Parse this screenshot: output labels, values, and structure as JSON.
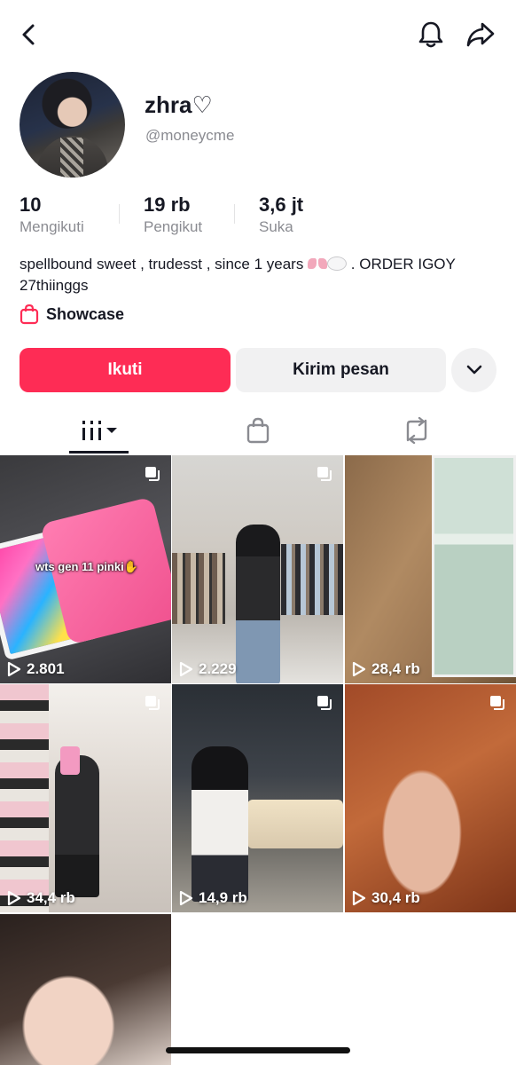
{
  "profile": {
    "name": "zhra♡",
    "handle": "@moneycme",
    "bio": {
      "text_before": "spellbound sweet , trudesst , since 1 years ",
      "text_after": " . ORDER IGOY 27thiinggs"
    },
    "showcase_label": "Showcase"
  },
  "stats": [
    {
      "value": "10",
      "label": "Mengikuti"
    },
    {
      "value": "19 rb",
      "label": "Pengikut"
    },
    {
      "value": "3,6 jt",
      "label": "Suka"
    }
  ],
  "actions": {
    "follow": "Ikuti",
    "message": "Kirim pesan"
  },
  "icons": {
    "back": "chevron-left-icon",
    "notification": "bell-icon",
    "share": "share-arrow-icon",
    "more": "chevron-down-icon",
    "tab_videos": "grid-bars-icon",
    "tab_shop": "shopping-bag-icon",
    "tab_repost": "repost-icon",
    "multi_photo": "stacked-photos-icon",
    "play": "play-icon"
  },
  "colors": {
    "accent": "#fe2c55",
    "secondary_button": "#f1f1f2",
    "muted_text": "#8a8b91"
  },
  "videos": [
    {
      "views": "2.801",
      "caption": "wts gen 11 pinki✋"
    },
    {
      "views": "2.229"
    },
    {
      "views": "28,4 rb"
    },
    {
      "views": "34,4 rb"
    },
    {
      "views": "14,9 rb"
    },
    {
      "views": "30,4 rb"
    },
    {
      "views": ""
    }
  ]
}
